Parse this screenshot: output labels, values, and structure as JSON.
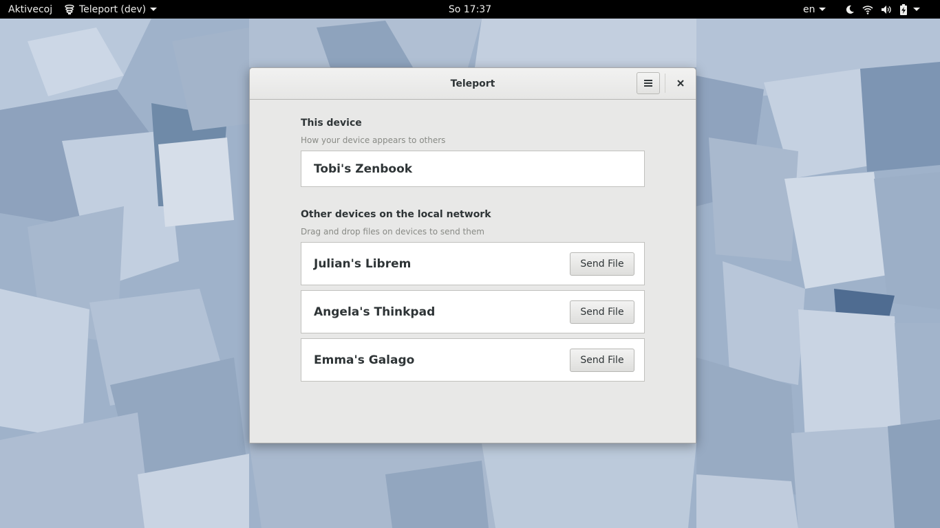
{
  "topbar": {
    "activities_label": "Aktivecoj",
    "app_menu_label": "Teleport (dev)",
    "clock": "So 17:37",
    "language": "en"
  },
  "window": {
    "title": "Teleport",
    "this_device": {
      "heading": "This device",
      "subtitle": "How your device appears to others",
      "name": "Tobi's Zenbook"
    },
    "others": {
      "heading": "Other devices on the local network",
      "subtitle": "Drag and drop files on devices to send them",
      "devices": [
        {
          "name": "Julian's Librem",
          "button": "Send File"
        },
        {
          "name": "Angela's Thinkpad",
          "button": "Send File"
        },
        {
          "name": "Emma's Galago",
          "button": "Send File"
        }
      ]
    }
  },
  "icons": {
    "app": "teleport-icon",
    "night": "night-light-icon",
    "wifi": "wifi-icon",
    "volume": "volume-icon",
    "battery": "battery-charging-icon",
    "menu": "hamburger-menu-icon",
    "close": "close-icon"
  },
  "colors": {
    "topbar": "#000000",
    "window_bg": "#e8e8e7",
    "text": "#2e3436",
    "subtitle": "#888a85"
  }
}
